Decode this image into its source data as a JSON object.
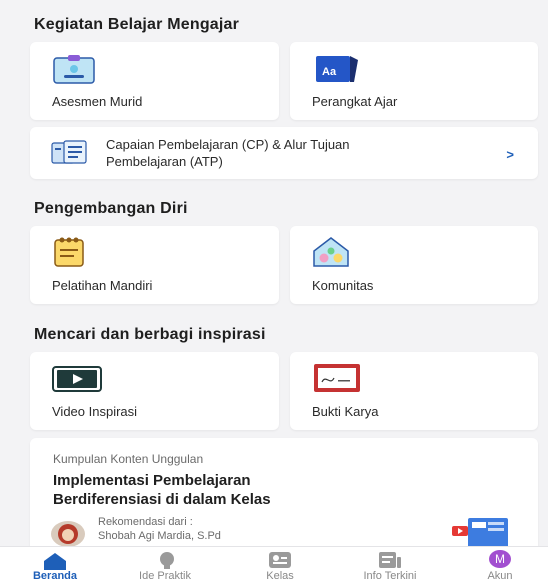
{
  "sections": {
    "kbm": {
      "title": "Kegiatan Belajar Mengajar",
      "cards": [
        "Asesmen Murid",
        "Perangkat Ajar"
      ],
      "wide": {
        "line1": "Capaian Pembelajaran (CP) & Alur Tujuan",
        "line2": "Pembelajaran (ATP)",
        "chevron": ">"
      },
      "aa_icon_text": "Aa"
    },
    "pengembangan": {
      "title": "Pengembangan Diri",
      "cards": [
        "Pelatihan Mandiri",
        "Komunitas"
      ]
    },
    "inspirasi": {
      "title": "Mencari dan berbagi inspirasi",
      "cards": [
        "Video Inspirasi",
        "Bukti Karya"
      ]
    }
  },
  "featured": {
    "kicker": "Kumpulan Konten Unggulan",
    "title_line1": "Implementasi Pembelajaran",
    "title_line2": "Berdiferensiasi di dalam Kelas",
    "recommend_label": "Rekomendasi dari :",
    "recommend_name": "Shobah Agi Mardia, S.Pd"
  },
  "bottom_nav": {
    "items": [
      "Beranda",
      "Ide Praktik",
      "Kelas",
      "Info Terkini",
      "Akun"
    ],
    "active": "Beranda",
    "avatar_letter": "M"
  },
  "colors": {
    "accent": "#1e5fb8",
    "avatar": "#a24fd0",
    "background": "#f3f3f5"
  },
  "icons": {
    "asesmen": "clipboard-icon",
    "perangkat": "book-icon",
    "cp_atp": "document-list-icon",
    "pelatihan": "notepad-icon",
    "komunitas": "house-icon",
    "video": "play-icon",
    "bukti": "certificate-icon",
    "beranda": "home-icon",
    "ide": "lightbulb-icon",
    "kelas": "classroom-icon",
    "info": "news-icon",
    "akun": "avatar-icon"
  }
}
